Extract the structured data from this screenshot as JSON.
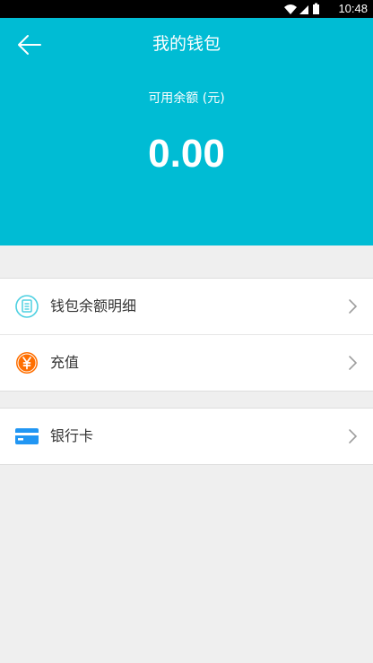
{
  "status_bar": {
    "time": "10:48",
    "icons": [
      "wifi-icon",
      "signal-icon",
      "battery-icon"
    ]
  },
  "header": {
    "title": "我的钱包",
    "back_icon": "arrow-left-icon",
    "balance_label": "可用余额 (元)",
    "balance_value": "0.00"
  },
  "menu": {
    "items": [
      {
        "label": "钱包余额明细",
        "icon": "document-list-icon"
      },
      {
        "label": "充值",
        "icon": "yen-coin-icon"
      },
      {
        "label": "银行卡",
        "icon": "bank-card-icon"
      }
    ]
  },
  "colors": {
    "header_bg": "#00bcd4",
    "page_bg": "#efefef",
    "doc_icon": "#4dd0e1",
    "coin_icon": "#ff6f00",
    "card_icon": "#2196f3"
  }
}
